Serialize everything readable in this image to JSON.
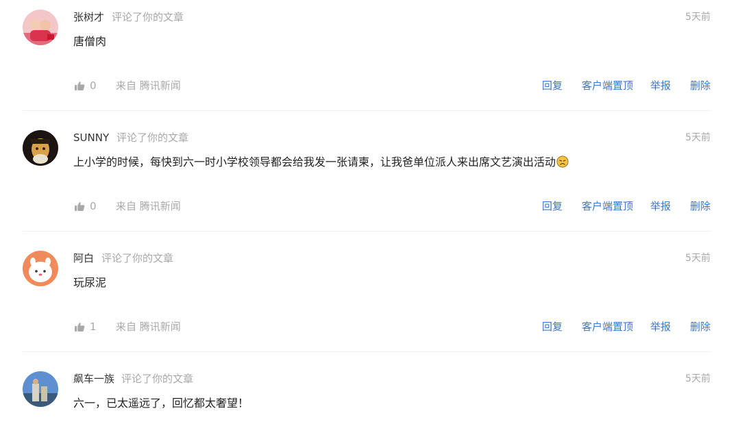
{
  "comments": [
    {
      "author": "张树才",
      "action": "评论了你的文章",
      "time": "5天前",
      "text": "唐僧肉",
      "likes": "0",
      "source": "来自 腾讯新闻",
      "reply": "回复",
      "pin": "客户端置顶",
      "report": "举报",
      "delete": "删除"
    },
    {
      "author": "SUNNY",
      "action": "评论了你的文章",
      "time": "5天前",
      "text": "上小学的时候，每快到六一时小学校领导都会给我发一张请柬，让我爸单位派人来出席文艺演出活动",
      "likes": "0",
      "source": "来自 腾讯新闻",
      "reply": "回复",
      "pin": "客户端置顶",
      "report": "举报",
      "delete": "删除"
    },
    {
      "author": "阿白",
      "action": "评论了你的文章",
      "time": "5天前",
      "text": "玩尿泥",
      "likes": "1",
      "source": "来自 腾讯新闻",
      "reply": "回复",
      "pin": "客户端置顶",
      "report": "举报",
      "delete": "删除"
    },
    {
      "author": "飙车一族",
      "action": "评论了你的文章",
      "time": "5天前",
      "text": "六一，已太遥远了，回忆都太奢望！"
    }
  ],
  "colors": {
    "link": "#3b76c8",
    "muted": "#a8a8a8",
    "text": "#222222"
  },
  "icons": {
    "like": "thumbs-up-icon",
    "emoji": "sad-face-emoji-icon"
  }
}
